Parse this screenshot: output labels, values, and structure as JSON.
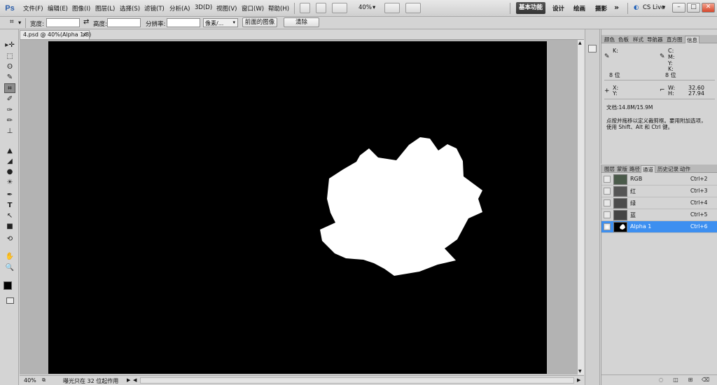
{
  "app": {
    "logo": "Ps"
  },
  "menu": [
    "文件(F)",
    "编辑(E)",
    "图像(I)",
    "图层(L)",
    "选择(S)",
    "滤镜(T)",
    "分析(A)",
    "3D(D)",
    "视图(V)",
    "窗口(W)",
    "帮助(H)"
  ],
  "menubar": {
    "zoom": "40%",
    "workspaces": [
      "基本功能",
      "设计",
      "绘画",
      "摄影"
    ],
    "more": "»",
    "cslive": "CS Live",
    "win_controls": [
      "–",
      "□",
      "✕"
    ]
  },
  "options": {
    "width_label": "宽度:",
    "swap": "⇄",
    "height_label": "高度:",
    "resolution_label": "分辨率:",
    "unit": "像素/...",
    "front_image": "前面的图像",
    "clear": "清除"
  },
  "tools": [
    "▸✛",
    "⬚",
    "ʘ",
    "✎",
    "⌗",
    "✐",
    "✑",
    "✏",
    "⊥",
    "▲",
    "◢",
    "●",
    "☀",
    "✒",
    "T",
    "↖",
    "■",
    "✋",
    "⟲",
    "🔍"
  ],
  "document": {
    "tab": "4.psd @ 40%(Alpha 1/8)"
  },
  "status": {
    "zoom": "40%",
    "info": "曝光只在 32 位起作用"
  },
  "info_panel": {
    "tabs": [
      "颜色",
      "色板",
      "样式",
      "导航器",
      "直方图",
      "信息"
    ],
    "r_label": "K:",
    "c_label": "C:",
    "m_label": "M:",
    "y_label": "Y:",
    "k_label": "K:",
    "bit_left": "8 位",
    "bit_right": "8 位",
    "x_label": "X:",
    "y2_label": "Y:",
    "w_label": "W:",
    "h_label": "H:",
    "w_value": "32.60",
    "h_value": "27.94",
    "doc": "文档:14.8M/15.9M",
    "hint1": "点按并拖移以定义裁剪框。要用附加选项，",
    "hint2": "使用 Shift、Alt 和 Ctrl 键。"
  },
  "channels_panel": {
    "tabs": [
      "图层",
      "蒙版",
      "路径",
      "通道",
      "历史记录",
      "动作"
    ],
    "rows": [
      {
        "name": "RGB",
        "shortcut": "Ctrl+2"
      },
      {
        "name": "红",
        "shortcut": "Ctrl+3"
      },
      {
        "name": "绿",
        "shortcut": "Ctrl+4"
      },
      {
        "name": "蓝",
        "shortcut": "Ctrl+5"
      },
      {
        "name": "Alpha 1",
        "shortcut": "Ctrl+6"
      }
    ]
  },
  "colors": {
    "selection": "#3d8ff0",
    "canvas": "#000000",
    "shape": "#ffffff"
  }
}
